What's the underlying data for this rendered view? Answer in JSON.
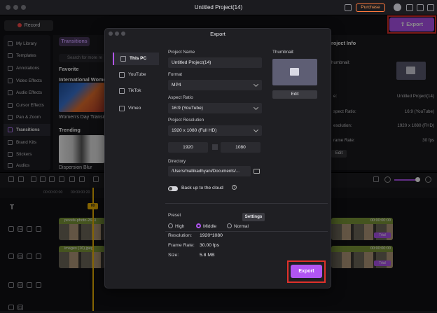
{
  "app": {
    "title": "Untitled Project(14)",
    "purchase_label": "Purchase"
  },
  "toolbar": {
    "record_label": "Record",
    "export_label": "Export"
  },
  "sidebar": {
    "items": [
      {
        "label": "My Library"
      },
      {
        "label": "Templates"
      },
      {
        "label": "Annotations"
      },
      {
        "label": "Video Effects"
      },
      {
        "label": "Audio Effects"
      },
      {
        "label": "Cursor Effects"
      },
      {
        "label": "Pan & Zoom"
      },
      {
        "label": "Transitions"
      },
      {
        "label": "Brand Kits"
      },
      {
        "label": "Stickers"
      },
      {
        "label": "Audios"
      }
    ],
    "active": "Transitions"
  },
  "transitions": {
    "tab_label": "Transitions",
    "search_placeholder": "Search for more re",
    "favorite_heading": "Favorite",
    "fav_item_title": "International Women",
    "fav_item_caption": "Women's Day Transit",
    "trending_heading": "Trending",
    "trend_item_caption": "Dispersion Blur"
  },
  "right_panel": {
    "heading": "roject Info",
    "thumbnail_label": "humbnail:",
    "rows": [
      {
        "label": "e:",
        "value": "Untitled Project(14)"
      },
      {
        "label": "spect Ratio:",
        "value": "16:9 (YouTube)"
      },
      {
        "label": "esolution:",
        "value": "1920 x 1080 (FHD)"
      },
      {
        "label": "rame Rate:",
        "value": "30 fps"
      }
    ],
    "edit_label": "Edit"
  },
  "timeline": {
    "ruler": [
      "00:00:00:00",
      "00:00:00:20"
    ],
    "playhead_label": "00",
    "tracks": [
      {
        "num": "04",
        "clip_label": "pexels-photo-2681"
      },
      {
        "num": "03",
        "clip_label": "images (16).jpeg"
      },
      {
        "num": "02"
      },
      {
        "num": "01"
      }
    ],
    "right_clip_times": [
      "00:00:00:00",
      "00:00:00:00"
    ],
    "trial_label": "Trial"
  },
  "export_dialog": {
    "title": "Export",
    "tabs": [
      {
        "label": "This PC",
        "icon": "monitor-icon"
      },
      {
        "label": "YouTube",
        "icon": "youtube-icon"
      },
      {
        "label": "TikTok",
        "icon": "tiktok-icon"
      },
      {
        "label": "Vimeo",
        "icon": "vimeo-icon"
      }
    ],
    "project_name_label": "Project Name",
    "project_name_value": "Untitled Project(14)",
    "format_label": "Format",
    "format_value": "MP4",
    "aspect_label": "Aspect Ratio",
    "aspect_value": "16:9 (YouTube)",
    "resolution_label": "Project Resolution",
    "resolution_value": "1920 x 1080 (Full HD)",
    "width_value": "1920",
    "height_value": "1080",
    "directory_label": "Directory",
    "directory_value": "/Users/mallikadhyani/Documents/...",
    "backup_label": "Back up to the cloud",
    "thumbnail_label": "Thumbnail:",
    "thumbnail_edit_label": "Edit",
    "preset_label": "Preset",
    "settings_label": "Settings",
    "presets": [
      "High",
      "Middle",
      "Normal"
    ],
    "selected_preset": "Middle",
    "summary": [
      {
        "label": "Resolution:",
        "value": "1920*1080"
      },
      {
        "label": "Frame Rate:",
        "value": "30.00 fps"
      },
      {
        "label": "Size:",
        "value": "5.8 MB"
      }
    ],
    "export_label": "Export"
  },
  "colors": {
    "accent": "#b155f2",
    "highlight_box": "#e0312b",
    "purchase": "#ff7a3d",
    "playhead": "#f2b705"
  }
}
